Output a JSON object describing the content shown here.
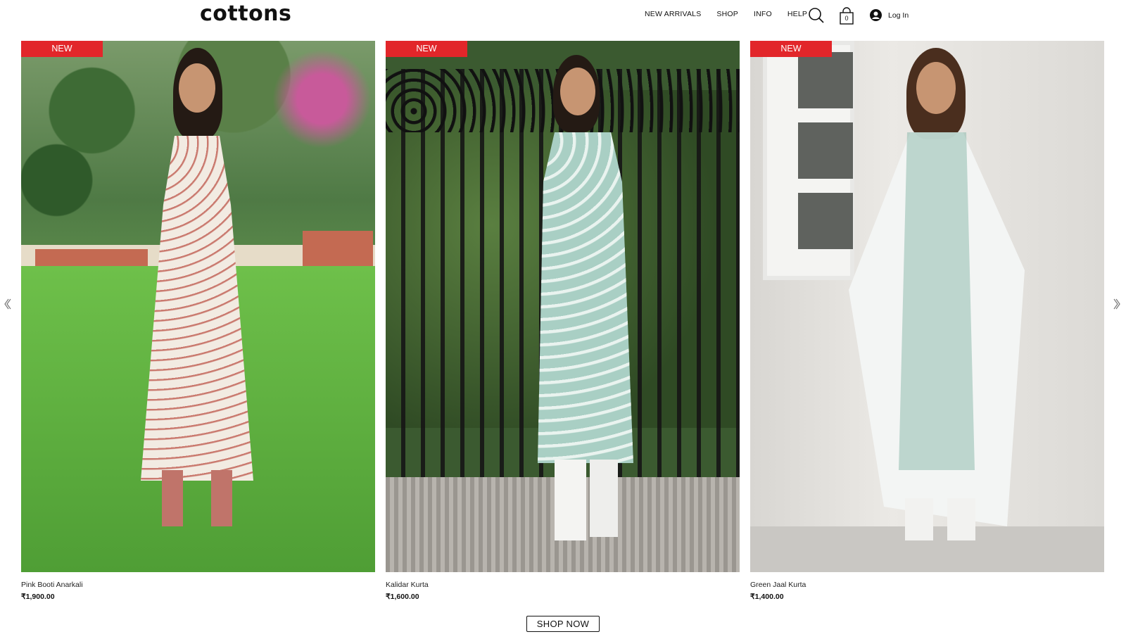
{
  "header": {
    "logo": "cottons",
    "nav": [
      "NEW ARRIVALS",
      "SHOP",
      "INFO",
      "HELP"
    ],
    "cart_count": "0",
    "login_label": "Log In"
  },
  "icons": {
    "search": "search-icon",
    "cart": "shopping-bag-icon",
    "account": "user-circle-icon",
    "prev": "chevron-left-icon",
    "next": "chevron-right-icon"
  },
  "colors": {
    "badge": "#e2262a",
    "text": "#111111"
  },
  "products": [
    {
      "badge": "NEW",
      "name": "Pink Booti Anarkali",
      "price": "₹1,900.00"
    },
    {
      "badge": "NEW",
      "name": "Kalidar Kurta",
      "price": "₹1,600.00"
    },
    {
      "badge": "NEW",
      "name": "Green Jaal Kurta",
      "price": "₹1,400.00"
    }
  ],
  "cta": {
    "shop_now": "SHOP NOW"
  }
}
